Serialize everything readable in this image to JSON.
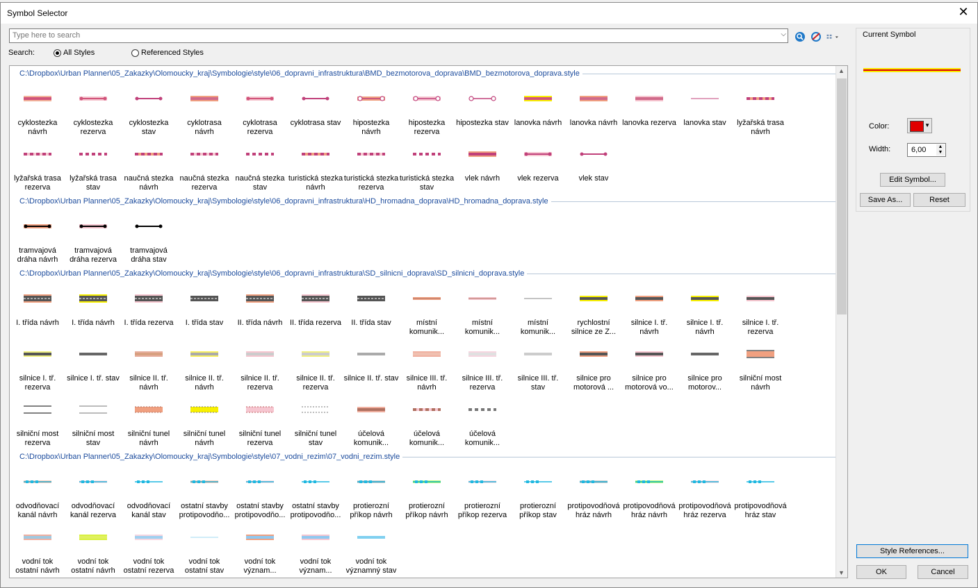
{
  "window": {
    "title": "Symbol Selector",
    "close": "✕"
  },
  "search": {
    "placeholder": "Type here to search",
    "label": "Search:",
    "opt_all": "All Styles",
    "opt_ref": "Referenced Styles"
  },
  "current": {
    "title": "Current Symbol",
    "color_label": "Color:",
    "width_label": "Width:",
    "width_value": "6,00",
    "color": "#e00000",
    "edit": "Edit Symbol...",
    "save_as": "Save As...",
    "reset": "Reset"
  },
  "bottom": {
    "style_refs": "Style References...",
    "ok": "OK",
    "cancel": "Cancel"
  },
  "groups": [
    {
      "path": "C:\\Dropbox\\Urban Planner\\05_Zakazky\\Olomoucky_kraj\\Symbologie\\style\\06_dopravni_infrastruktura\\BMD_bezmotorova_doprava\\BMD_bezmotorova_doprava.style",
      "items": [
        {
          "label": "cyklostezka návrh",
          "kind": "band",
          "c1": "#f2b39b",
          "c2": "#d0537a"
        },
        {
          "label": "cyklostezka rezerva",
          "kind": "dotline",
          "c1": "#f6c6d0",
          "c2": "#d0537a"
        },
        {
          "label": "cyklostezka stav",
          "kind": "dotline",
          "c1": "#ffffff",
          "c2": "#c0407a"
        },
        {
          "label": "cyklotrasa návrh",
          "kind": "band",
          "c1": "#f0a080",
          "c2": "#d06a8a"
        },
        {
          "label": "cyklotrasa rezerva",
          "kind": "dotline",
          "c1": "#f6c6d0",
          "c2": "#d0537a"
        },
        {
          "label": "cyklotrasa stav",
          "kind": "dotline",
          "c1": "#ffffff",
          "c2": "#c0407a"
        },
        {
          "label": "hipostezka návrh",
          "kind": "ring",
          "c1": "#f0a080",
          "c2": "#c0407a"
        },
        {
          "label": "hipostezka rezerva",
          "kind": "ring",
          "c1": "#f6c6d0",
          "c2": "#c0407a"
        },
        {
          "label": "hipostezka stav",
          "kind": "ring",
          "c1": "#ffffff",
          "c2": "#c0407a"
        },
        {
          "label": "lanovka návrh",
          "kind": "band",
          "c1": "#f8f000",
          "c2": "#d0537a"
        },
        {
          "label": "lanovka návrh",
          "kind": "band",
          "c1": "#f0a080",
          "c2": "#d06a8a"
        },
        {
          "label": "lanovka rezerva",
          "kind": "band",
          "c1": "#f6c6d0",
          "c2": "#d06a8a"
        },
        {
          "label": "lanovka stav",
          "kind": "thin",
          "c1": "#ffffff",
          "c2": "#c0407a"
        },
        {
          "label": "lyžařská trasa návrh",
          "kind": "dash",
          "c1": "#f0a080",
          "c2": "#c0407a"
        },
        {
          "label": "lyžařská trasa rezerva",
          "kind": "dash",
          "c1": "#f6c6d0",
          "c2": "#c0407a"
        },
        {
          "label": "lyžařská trasa stav",
          "kind": "dash",
          "c1": "#ffffff",
          "c2": "#c0407a"
        },
        {
          "label": "naučná stezka návrh",
          "kind": "dash",
          "c1": "#f0a080",
          "c2": "#c0407a"
        },
        {
          "label": "naučná stezka rezerva",
          "kind": "dash",
          "c1": "#f6c6d0",
          "c2": "#c0407a"
        },
        {
          "label": "naučná stezka stav",
          "kind": "dash",
          "c1": "#ffffff",
          "c2": "#c0407a"
        },
        {
          "label": "turistická stezka návrh",
          "kind": "dash",
          "c1": "#f0a080",
          "c2": "#c0407a"
        },
        {
          "label": "turistická stezka rezerva",
          "kind": "dash",
          "c1": "#f6c6d0",
          "c2": "#c0407a"
        },
        {
          "label": "turistická stezka stav",
          "kind": "dash",
          "c1": "#ffffff",
          "c2": "#c0407a"
        },
        {
          "label": "vlek návrh",
          "kind": "band",
          "c1": "#f0a080",
          "c2": "#c0407a"
        },
        {
          "label": "vlek rezerva",
          "kind": "dotline",
          "c1": "#f6c6d0",
          "c2": "#c0407a"
        },
        {
          "label": "vlek stav",
          "kind": "dotline",
          "c1": "#ffffff",
          "c2": "#c0407a"
        }
      ]
    },
    {
      "path": "C:\\Dropbox\\Urban Planner\\05_Zakazky\\Olomoucky_kraj\\Symbologie\\style\\06_dopravni_infrastruktura\\HD_hromadna_doprava\\HD_hromadna_doprava.style",
      "items": [
        {
          "label": "tramvajová dráha návrh",
          "kind": "dotline",
          "c1": "#f0a080",
          "c2": "#000000"
        },
        {
          "label": "tramvajová dráha rezerva",
          "kind": "dotline",
          "c1": "#f6c6d0",
          "c2": "#000000"
        },
        {
          "label": "tramvajová dráha stav",
          "kind": "dotline",
          "c1": "#ffffff",
          "c2": "#000000"
        }
      ]
    },
    {
      "path": "C:\\Dropbox\\Urban Planner\\05_Zakazky\\Olomoucky_kraj\\Symbologie\\style\\06_dopravni_infrastruktura\\SD_silnicni_doprava\\SD_silnicni_doprava.style",
      "items": [
        {
          "label": "I. třída návrh",
          "kind": "road",
          "c1": "#f0a080",
          "c2": "#555555"
        },
        {
          "label": "I. třída návrh",
          "kind": "road",
          "c1": "#f8f000",
          "c2": "#555555"
        },
        {
          "label": "I. třída rezerva",
          "kind": "road",
          "c1": "#f6c6d0",
          "c2": "#555555"
        },
        {
          "label": "I. třída stav",
          "kind": "road",
          "c1": "#ffffff",
          "c2": "#555555"
        },
        {
          "label": "II. třída návrh",
          "kind": "road",
          "c1": "#f0a080",
          "c2": "#555555"
        },
        {
          "label": "II. třída rezerva",
          "kind": "road",
          "c1": "#f6c6d0",
          "c2": "#555555"
        },
        {
          "label": "II. třída stav",
          "kind": "road",
          "c1": "#ffffff",
          "c2": "#555555"
        },
        {
          "label": "místní komunik...",
          "kind": "thin",
          "c1": "#f0a080",
          "c2": "#b07060"
        },
        {
          "label": "místní komunik...",
          "kind": "thin",
          "c1": "#f6c6d0",
          "c2": "#b07060"
        },
        {
          "label": "místní komunik...",
          "kind": "thin",
          "c1": "#ffffff",
          "c2": "#888888"
        },
        {
          "label": "rychlostní silnice ze Z...",
          "kind": "band",
          "c1": "#f8f000",
          "c2": "#555555"
        },
        {
          "label": "silnice I. tř. návrh",
          "kind": "band",
          "c1": "#f0a080",
          "c2": "#555555"
        },
        {
          "label": "silnice I. tř. návrh",
          "kind": "band",
          "c1": "#f8f000",
          "c2": "#555555"
        },
        {
          "label": "silnice I. tř. rezerva",
          "kind": "band",
          "c1": "#f6c6d0",
          "c2": "#555555"
        },
        {
          "label": "silnice I. tř. rezerva",
          "kind": "band",
          "c1": "#f0f080",
          "c2": "#555555"
        },
        {
          "label": "silnice I. tř. stav",
          "kind": "band",
          "c1": "#ffffff",
          "c2": "#666666"
        },
        {
          "label": "silnice II. tř. návrh",
          "kind": "band",
          "c1": "#e8b0a0",
          "c2": "#d8a080"
        },
        {
          "label": "silnice II. tř. návrh",
          "kind": "band",
          "c1": "#f8f060",
          "c2": "#aaaaaa"
        },
        {
          "label": "silnice II. tř. rezerva",
          "kind": "band",
          "c1": "#f6c6d0",
          "c2": "#cccccc"
        },
        {
          "label": "silnice II. tř. rezerva",
          "kind": "band",
          "c1": "#f0f080",
          "c2": "#cccccc"
        },
        {
          "label": "silnice II. tř. stav",
          "kind": "band",
          "c1": "#ffffff",
          "c2": "#aaaaaa"
        },
        {
          "label": "silnice III. tř. návrh",
          "kind": "band",
          "c1": "#f0b0a0",
          "c2": "#f0c0b0"
        },
        {
          "label": "silnice III. tř. rezerva",
          "kind": "band",
          "c1": "#f6d6e0",
          "c2": "#e0e0e0"
        },
        {
          "label": "silnice III. tř. stav",
          "kind": "band",
          "c1": "#ffffff",
          "c2": "#cccccc"
        },
        {
          "label": "silnice pro motorová ...",
          "kind": "band",
          "c1": "#f0a080",
          "c2": "#555555"
        },
        {
          "label": "silnice pro motorová vo...",
          "kind": "band",
          "c1": "#f6c6d0",
          "c2": "#555555"
        },
        {
          "label": "silnice pro motorov...",
          "kind": "band",
          "c1": "#ffffff",
          "c2": "#666666"
        },
        {
          "label": "silniční most návrh",
          "kind": "bridge",
          "c1": "#f0a080",
          "c2": "#000000"
        },
        {
          "label": "silniční most rezerva",
          "kind": "bridge",
          "c1": "#ffffff",
          "c2": "#000000"
        },
        {
          "label": "silniční most stav",
          "kind": "bridge",
          "c1": "#ffffff",
          "c2": "#777777"
        },
        {
          "label": "silniční tunel návrh",
          "kind": "tunnel",
          "c1": "#f0a080",
          "c2": "#b07060"
        },
        {
          "label": "silniční tunel návrh",
          "kind": "tunnel",
          "c1": "#f8f000",
          "c2": "#777777"
        },
        {
          "label": "silniční tunel rezerva",
          "kind": "tunnel",
          "c1": "#f6c6d0",
          "c2": "#c06060"
        },
        {
          "label": "silniční tunel stav",
          "kind": "tunnel",
          "c1": "#ffffff",
          "c2": "#777777"
        },
        {
          "label": "účelová komunik...",
          "kind": "band",
          "c1": "#f0b0a0",
          "c2": "#b07060"
        },
        {
          "label": "účelová komunik...",
          "kind": "dash",
          "c1": "#f6c6d0",
          "c2": "#b07060"
        },
        {
          "label": "účelová komunik...",
          "kind": "dash",
          "c1": "#ffffff",
          "c2": "#777777"
        }
      ]
    },
    {
      "path": "C:\\Dropbox\\Urban Planner\\05_Zakazky\\Olomoucky_kraj\\Symbologie\\style\\07_vodni_rezim\\07_vodni_rezim.style",
      "items": [
        {
          "label": "odvodňovací kanál návrh",
          "kind": "water",
          "c1": "#f0a080",
          "c2": "#20b8e0"
        },
        {
          "label": "odvodňovací kanál rezerva",
          "kind": "water",
          "c1": "#f6c6d0",
          "c2": "#20b8e0"
        },
        {
          "label": "odvodňovací kanál stav",
          "kind": "water",
          "c1": "#ffffff",
          "c2": "#20b8e0"
        },
        {
          "label": "ostatní stavby protipovodňo...",
          "kind": "water",
          "c1": "#f0a080",
          "c2": "#20b8e0"
        },
        {
          "label": "ostatní stavby protipovodňo...",
          "kind": "water",
          "c1": "#f6c6d0",
          "c2": "#20b8e0"
        },
        {
          "label": "ostatní stavby protipovodňo...",
          "kind": "water",
          "c1": "#ffffff",
          "c2": "#20b8e0"
        },
        {
          "label": "protierozní příkop návrh",
          "kind": "water",
          "c1": "#a0a0a0",
          "c2": "#20b8e0"
        },
        {
          "label": "protierozní příkop návrh",
          "kind": "water",
          "c1": "#80f000",
          "c2": "#20b8e0"
        },
        {
          "label": "protierozní příkop rezerva",
          "kind": "water",
          "c1": "#f6c6d0",
          "c2": "#20b8e0"
        },
        {
          "label": "protierozní příkop stav",
          "kind": "water",
          "c1": "#ffffff",
          "c2": "#20b8e0"
        },
        {
          "label": "protipovodňová hráz návrh",
          "kind": "water",
          "c1": "#a0a0a0",
          "c2": "#20b8e0"
        },
        {
          "label": "protipovodňová hráz návrh",
          "kind": "water",
          "c1": "#80f000",
          "c2": "#20b8e0"
        },
        {
          "label": "protipovodňová hráz rezerva",
          "kind": "water",
          "c1": "#f6c6d0",
          "c2": "#20b8e0"
        },
        {
          "label": "protipovodňová hráz stav",
          "kind": "water",
          "c1": "#ffffff",
          "c2": "#20b8e0"
        },
        {
          "label": "vodní tok ostatní návrh",
          "kind": "band",
          "c1": "#f0b0a0",
          "c2": "#a0c8e0"
        },
        {
          "label": "vodní tok ostatní návrh",
          "kind": "band",
          "c1": "#d8f040",
          "c2": "#e0f060"
        },
        {
          "label": "vodní tok ostatní rezerva",
          "kind": "band",
          "c1": "#f6d6e0",
          "c2": "#a0d0f0"
        },
        {
          "label": "vodní tok ostatní stav",
          "kind": "thin",
          "c1": "#ffffff",
          "c2": "#a0d8f0"
        },
        {
          "label": "vodní tok význam...",
          "kind": "band",
          "c1": "#f0a080",
          "c2": "#90c8f0"
        },
        {
          "label": "vodní tok význam...",
          "kind": "band",
          "c1": "#f6c6d0",
          "c2": "#90c8f0"
        },
        {
          "label": "vodní tok významný stav",
          "kind": "band",
          "c1": "#ffffff",
          "c2": "#80d0f0"
        }
      ]
    }
  ]
}
